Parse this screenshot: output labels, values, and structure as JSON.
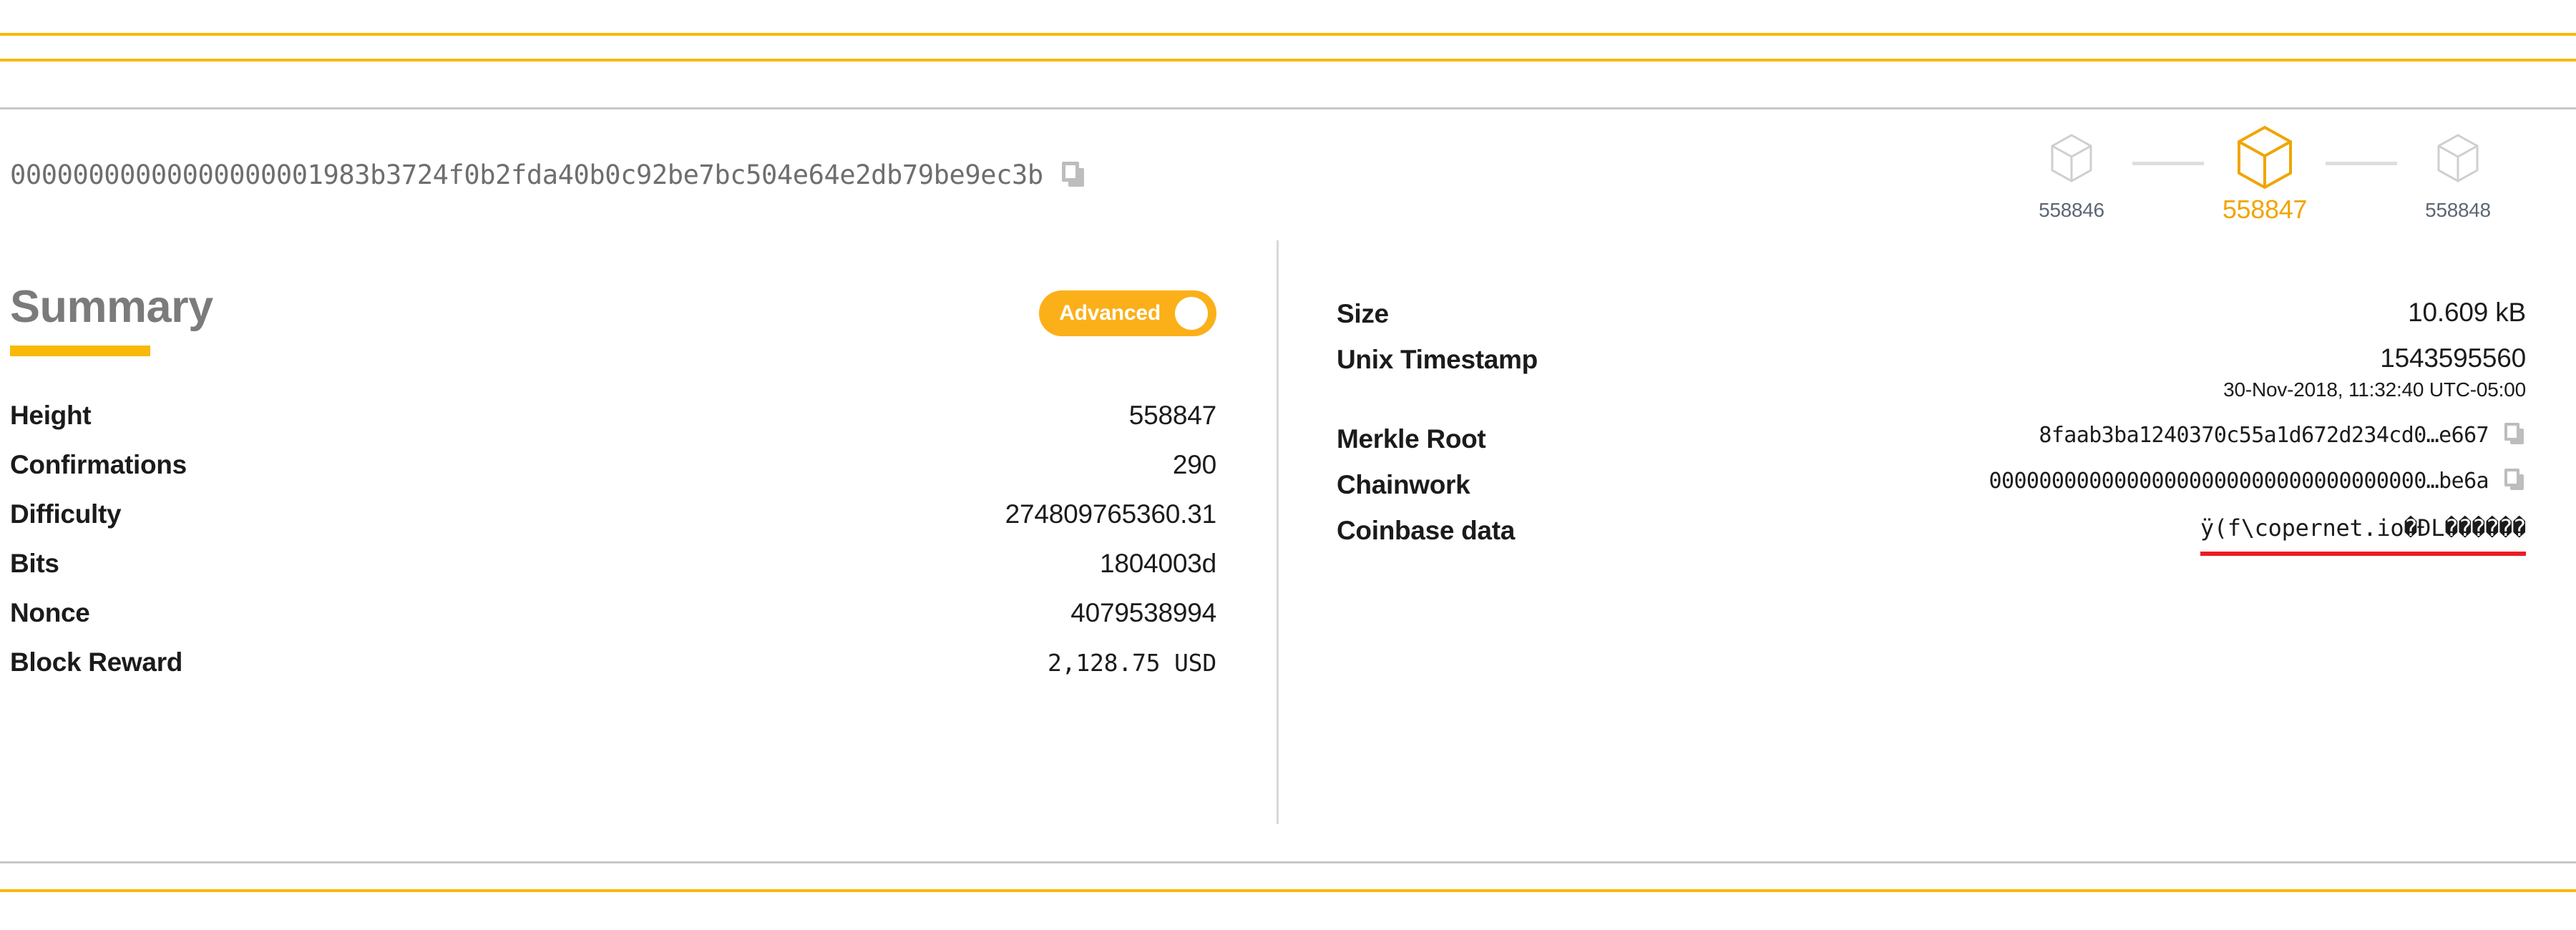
{
  "header": {
    "block_hash": "00000000000000000001983b3724f0b2fda40b0c92be7bc504e64e2db79be9ec3b",
    "copy_icon": "copy-icon",
    "accent_color": "#f8b90b"
  },
  "block_nav": {
    "previous": {
      "height": "558846",
      "icon": "cube-icon"
    },
    "current": {
      "height": "558847",
      "icon": "cube-icon"
    },
    "next": {
      "height": "558848",
      "icon": "cube-icon"
    }
  },
  "summary": {
    "title": "Summary",
    "toggle": {
      "label": "Advanced",
      "state": "on"
    },
    "rows": [
      {
        "label": "Height",
        "value": "558847",
        "mono": false
      },
      {
        "label": "Confirmations",
        "value": "290",
        "mono": false
      },
      {
        "label": "Difficulty",
        "value": "274809765360.31",
        "mono": false
      },
      {
        "label": "Bits",
        "value": "1804003d",
        "mono": false
      },
      {
        "label": "Nonce",
        "value": "4079538994",
        "mono": false
      },
      {
        "label": "Block Reward",
        "value": "2,128.75 USD",
        "mono": true
      }
    ]
  },
  "details": {
    "size": {
      "label": "Size",
      "value": "10.609 kB"
    },
    "unix_timestamp": {
      "label": "Unix Timestamp",
      "value": "1543595560",
      "sub_value": "30-Nov-2018, 11:32:40 UTC-05:00"
    },
    "merkle_root": {
      "label": "Merkle Root",
      "value": "8faab3ba1240370c55a1d672d234cd0…e667",
      "copy_icon": "copy-icon"
    },
    "chainwork": {
      "label": "Chainwork",
      "value": "00000000000000000000000000000000000…be6a",
      "copy_icon": "copy-icon"
    },
    "coinbase_data": {
      "label": "Coinbase data",
      "value": "ÿ(f\\copernet.io�ÐL������",
      "underline_color": "#ec1c24"
    }
  }
}
